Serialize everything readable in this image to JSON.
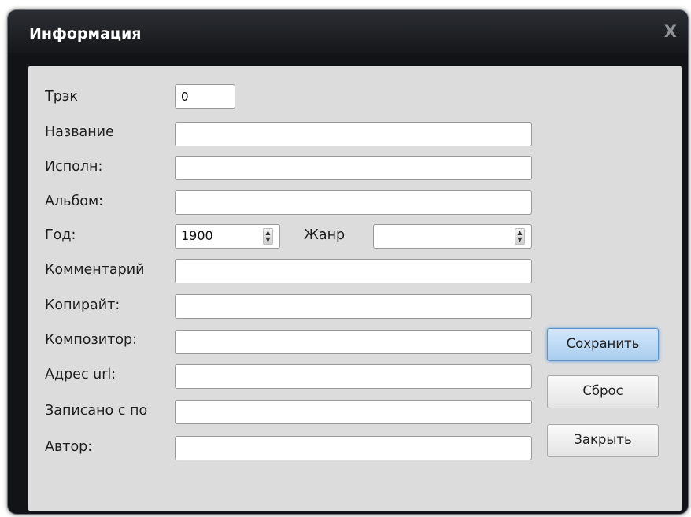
{
  "window": {
    "title": "Информация",
    "close_glyph": "X"
  },
  "form": {
    "track": {
      "label": "Трэк",
      "value": "0"
    },
    "title": {
      "label": "Название",
      "value": ""
    },
    "artist": {
      "label": "Исполн:",
      "value": ""
    },
    "album": {
      "label": "Альбом:",
      "value": ""
    },
    "year": {
      "label": "Год:",
      "value": "1900"
    },
    "genre": {
      "label": "Жанр",
      "value": ""
    },
    "comment": {
      "label": "Комментарий",
      "value": ""
    },
    "copyright": {
      "label": "Копирайт:",
      "value": ""
    },
    "composer": {
      "label": "Композитор:",
      "value": ""
    },
    "url": {
      "label": "Адрес url:",
      "value": ""
    },
    "encoded_by": {
      "label": "Записано с по",
      "value": ""
    },
    "author": {
      "label": "Автор:",
      "value": ""
    }
  },
  "buttons": {
    "save": "Сохранить",
    "reset": "Сброс",
    "close": "Закрыть"
  },
  "icons": {
    "close": "close-icon",
    "spinner": "spinner-arrows-icon"
  },
  "colors": {
    "titlebar": "#1b1d21",
    "client_bg": "#dcdcdc",
    "focus_button": "#a9cdee"
  }
}
